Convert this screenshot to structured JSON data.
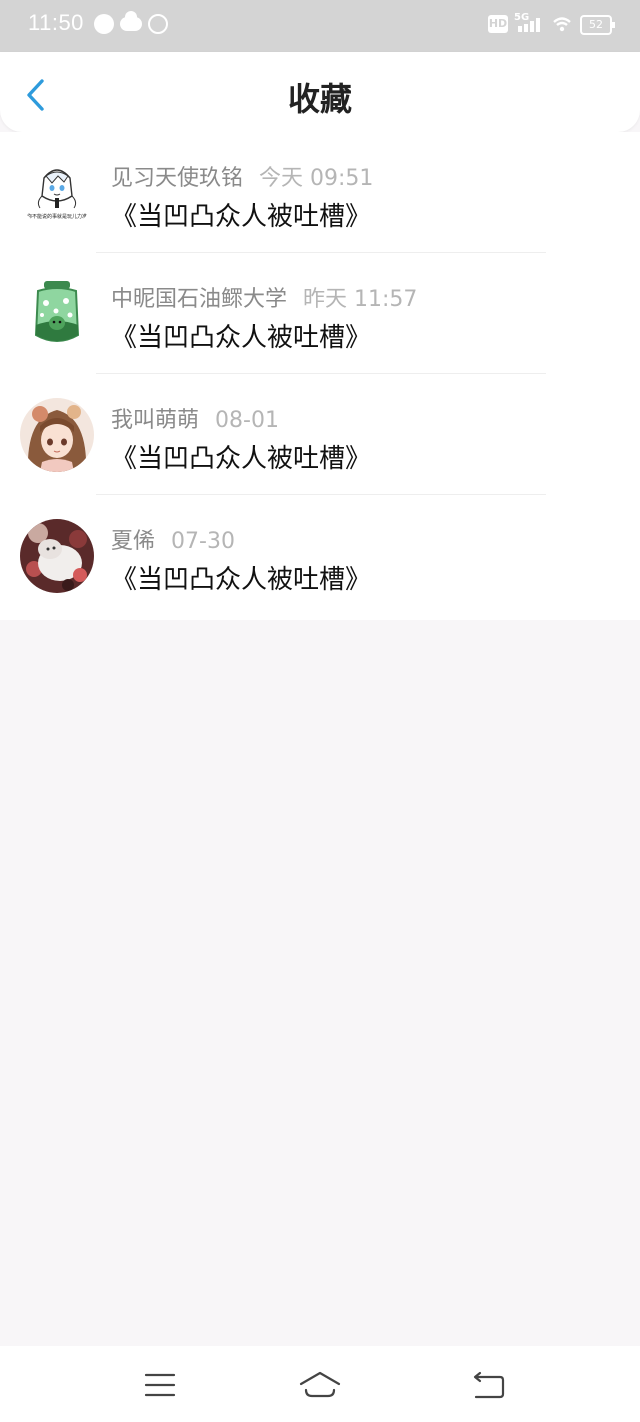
{
  "status_bar": {
    "time": "11:50",
    "network": "5G",
    "hd_label": "HD",
    "battery": "52",
    "icons": [
      "compass-icon",
      "cloud-icon",
      "circle-icon",
      "hd-icon",
      "signal-icon",
      "wifi-icon",
      "battery-icon"
    ]
  },
  "header": {
    "title": "收藏",
    "back_icon": "chevron-left-icon",
    "accent_color": "#2e9bdc"
  },
  "favorites": [
    {
      "name": "见习天使玖铭",
      "time": "今天  09:51",
      "message": "《当凹凸众人被吐槽》",
      "avatar_text": "你不能说的事就是玩儿力准"
    },
    {
      "name": "中昵国石油鳏大学",
      "time": "昨天  11:57",
      "message": "《当凹凸众人被吐槽》"
    },
    {
      "name": "我叫萌萌",
      "time": "08-01",
      "message": "《当凹凸众人被吐槽》"
    },
    {
      "name": "夏俙",
      "time": "07-30",
      "message": "《当凹凸众人被吐槽》"
    }
  ],
  "nav_bar": {
    "icons": [
      "menu-icon",
      "home-icon",
      "back-icon"
    ]
  }
}
